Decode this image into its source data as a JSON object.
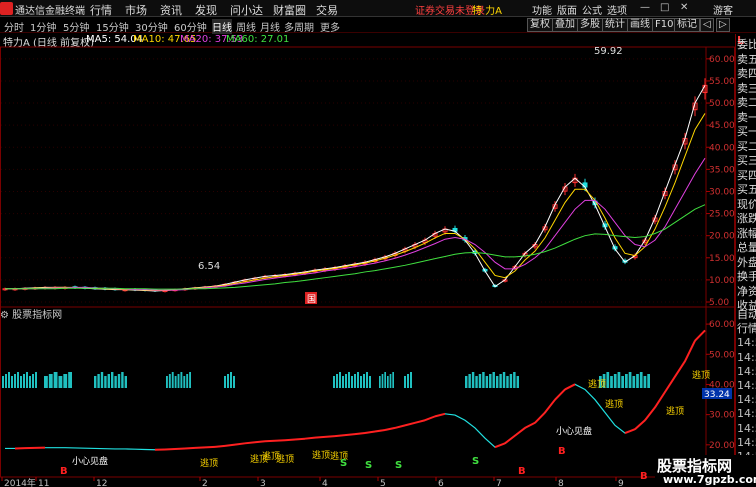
{
  "app": {
    "title": "通达信金融终端",
    "menu": [
      "行情",
      "市场",
      "资讯",
      "发现",
      "问小达",
      "财富圈",
      "交易"
    ],
    "login_status": "证券交易未登录",
    "stock_name": "特 力A",
    "right_menu": [
      "功能",
      "版面",
      "公式",
      "选项",
      "游客"
    ],
    "window_controls": [
      "—",
      "□",
      "✕"
    ]
  },
  "toolbar": {
    "periods": [
      "分时",
      "1分钟",
      "5分钟",
      "15分钟",
      "30分钟",
      "60分钟",
      "日线",
      "周线",
      "月线",
      "多周期",
      "更多"
    ],
    "active_period": "日线",
    "tools": [
      "复权",
      "叠加",
      "多股",
      "统计",
      "画线",
      "F10",
      "标记",
      "◁",
      "▷"
    ]
  },
  "info": {
    "stock_label": "特力A (日线 前复权)",
    "ma5": "MA5: 54.04",
    "ma10": "MA10: 47.65",
    "ma20": "MA20: 37.53",
    "ma60": "MA60: 27.01",
    "colors": {
      "ma5": "#ffffff",
      "ma10": "#ffd700",
      "ma20": "#e040e0",
      "ma60": "#40e040"
    }
  },
  "price_axis": [
    "60.00",
    "55.00",
    "50.00",
    "45.00",
    "40.00",
    "35.00",
    "30.00",
    "25.00",
    "20.00",
    "15.00",
    "10.00",
    "5.00"
  ],
  "price_annotations": {
    "high": "59.92",
    "low": "6.54",
    "marker": "国"
  },
  "indicator": {
    "title": "股票指标网",
    "axis": [
      "60.00",
      "50.00",
      "40.00",
      "30.00",
      "20.00"
    ],
    "current_value": "33.24",
    "labels_top": [
      "逃顶",
      "逃顶"
    ],
    "labels_bottom": [
      "小心见盘",
      "逃顶",
      "逃顶",
      "逃顶",
      "逃顶",
      "逃顶",
      "逃顶",
      "小心见盘",
      "逃顶",
      "逃顶"
    ],
    "signal_b": "B",
    "signal_s": "S"
  },
  "date_axis": [
    "2014年",
    "11",
    "12",
    "2",
    "3",
    "4",
    "5",
    "6",
    "7",
    "8",
    "9",
    "10"
  ],
  "side_panel": {
    "top_marker": "L",
    "items": [
      "委比",
      "卖五",
      "卖四",
      "卖三",
      "卖二",
      "卖一",
      "买一",
      "买二",
      "买三",
      "买四",
      "买五",
      "现价",
      "涨跌",
      "涨幅",
      "总量",
      "外盘",
      "换手",
      "净资",
      "收益"
    ],
    "lower_items": [
      "自动",
      "行情",
      "14:50",
      "14:50",
      "14:50",
      "14:50",
      "14:50",
      "14:50",
      "14:50",
      "14:50",
      "14:50",
      "14:50"
    ]
  },
  "watermark": {
    "title": "股票指标网",
    "url": "www.7gpzb.com"
  },
  "chart_data": {
    "type": "line",
    "title": "",
    "xlabel": "",
    "ylabel": "",
    "ylim": [
      5,
      62
    ],
    "x": [
      0,
      10,
      20,
      30,
      40,
      50,
      60,
      70,
      80,
      90,
      100,
      110,
      120,
      130,
      140,
      150,
      160,
      170,
      180,
      190,
      200,
      210,
      220,
      230,
      240,
      250,
      260,
      270,
      280,
      290,
      300,
      310,
      320,
      330,
      340,
      350,
      360,
      370,
      380,
      390,
      400,
      410,
      420,
      430,
      440,
      450,
      460,
      470,
      480,
      490,
      500,
      510,
      520,
      530,
      540,
      550,
      560,
      570,
      580,
      590,
      600,
      610,
      620,
      630,
      640,
      650,
      660,
      670,
      680,
      690,
      700
    ],
    "series": [
      {
        "name": "MA5",
        "values": [
          8.0,
          8.0,
          8.1,
          8.2,
          8.3,
          8.3,
          8.3,
          8.2,
          8.1,
          8.0,
          7.9,
          7.8,
          7.8,
          7.7,
          7.6,
          7.5,
          7.6,
          7.8,
          8.0,
          8.2,
          8.4,
          8.6,
          9.0,
          9.5,
          10.0,
          10.4,
          10.8,
          11.0,
          11.2,
          11.5,
          11.8,
          12.2,
          12.5,
          12.8,
          13.2,
          13.6,
          14.0,
          14.6,
          15.2,
          16.0,
          17.0,
          18.0,
          19.0,
          20.5,
          21.5,
          21.0,
          19.0,
          16.0,
          12.0,
          8.5,
          10.0,
          13.0,
          16.0,
          18.0,
          22.0,
          27.0,
          31.0,
          33.0,
          31.0,
          27.0,
          22.0,
          17.0,
          14.0,
          15.5,
          19.0,
          24.0,
          30.0,
          36.0,
          42.0,
          50.0,
          54.0
        ]
      },
      {
        "name": "MA10",
        "values": [
          8.0,
          8.0,
          8.0,
          8.1,
          8.2,
          8.3,
          8.3,
          8.3,
          8.2,
          8.1,
          8.0,
          7.9,
          7.8,
          7.8,
          7.7,
          7.6,
          7.6,
          7.7,
          7.9,
          8.1,
          8.3,
          8.5,
          8.8,
          9.2,
          9.6,
          10.0,
          10.4,
          10.7,
          11.0,
          11.3,
          11.6,
          12.0,
          12.3,
          12.6,
          13.0,
          13.4,
          13.8,
          14.3,
          14.9,
          15.6,
          16.4,
          17.3,
          18.3,
          19.5,
          20.5,
          20.5,
          19.2,
          17.0,
          14.0,
          11.0,
          10.5,
          12.0,
          14.5,
          16.5,
          19.5,
          23.5,
          27.5,
          30.5,
          30.5,
          28.0,
          24.0,
          19.5,
          16.0,
          15.5,
          17.5,
          21.5,
          26.5,
          32.0,
          38.0,
          44.0,
          47.65
        ]
      },
      {
        "name": "MA20",
        "values": [
          8.0,
          8.0,
          8.0,
          8.0,
          8.1,
          8.2,
          8.2,
          8.3,
          8.3,
          8.2,
          8.1,
          8.0,
          7.9,
          7.8,
          7.8,
          7.7,
          7.7,
          7.7,
          7.8,
          8.0,
          8.2,
          8.4,
          8.6,
          9.0,
          9.3,
          9.7,
          10.1,
          10.4,
          10.7,
          11.0,
          11.3,
          11.6,
          12.0,
          12.3,
          12.6,
          13.0,
          13.4,
          13.8,
          14.3,
          14.9,
          15.6,
          16.4,
          17.3,
          18.2,
          19.2,
          19.6,
          19.2,
          18.0,
          16.2,
          14.0,
          12.5,
          12.5,
          13.5,
          15.0,
          17.0,
          20.0,
          23.0,
          26.0,
          28.0,
          28.0,
          26.0,
          23.0,
          20.0,
          18.0,
          17.5,
          19.0,
          22.0,
          26.0,
          30.0,
          34.0,
          37.53
        ]
      },
      {
        "name": "MA60",
        "values": [
          8.0,
          8.0,
          8.0,
          8.0,
          8.0,
          8.0,
          8.1,
          8.1,
          8.1,
          8.1,
          8.1,
          8.1,
          8.0,
          8.0,
          8.0,
          7.9,
          7.9,
          7.9,
          7.9,
          8.0,
          8.0,
          8.1,
          8.2,
          8.3,
          8.5,
          8.7,
          8.9,
          9.1,
          9.4,
          9.6,
          9.9,
          10.2,
          10.5,
          10.8,
          11.1,
          11.4,
          11.8,
          12.1,
          12.5,
          12.9,
          13.3,
          13.8,
          14.3,
          14.8,
          15.3,
          15.8,
          16.1,
          16.2,
          16.0,
          15.6,
          15.2,
          15.2,
          15.4,
          15.8,
          16.4,
          17.2,
          18.2,
          19.2,
          20.0,
          20.4,
          20.3,
          20.0,
          19.8,
          19.6,
          19.8,
          20.5,
          21.5,
          23.0,
          24.5,
          26.0,
          27.01
        ]
      }
    ]
  }
}
